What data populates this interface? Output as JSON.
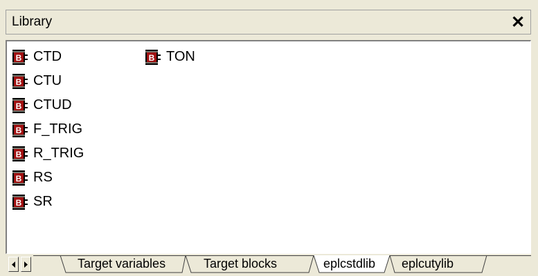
{
  "panel": {
    "title": "Library",
    "close_label": "✕"
  },
  "library": {
    "items": [
      {
        "label": "CTD",
        "icon": "function-block-icon"
      },
      {
        "label": "CTU",
        "icon": "function-block-icon"
      },
      {
        "label": "CTUD",
        "icon": "function-block-icon"
      },
      {
        "label": "F_TRIG",
        "icon": "function-block-icon"
      },
      {
        "label": "R_TRIG",
        "icon": "function-block-icon"
      },
      {
        "label": "RS",
        "icon": "function-block-icon"
      },
      {
        "label": "SR",
        "icon": "function-block-icon"
      },
      {
        "label": "TON",
        "icon": "function-block-icon"
      }
    ],
    "icon_letter": "B",
    "icon_color": "#a01010"
  },
  "tabs": {
    "items": [
      {
        "label": "Target variables",
        "active": false
      },
      {
        "label": "Target blocks",
        "active": false
      },
      {
        "label": "eplcstdlib",
        "active": true
      },
      {
        "label": "eplcutylib",
        "active": false
      }
    ]
  }
}
